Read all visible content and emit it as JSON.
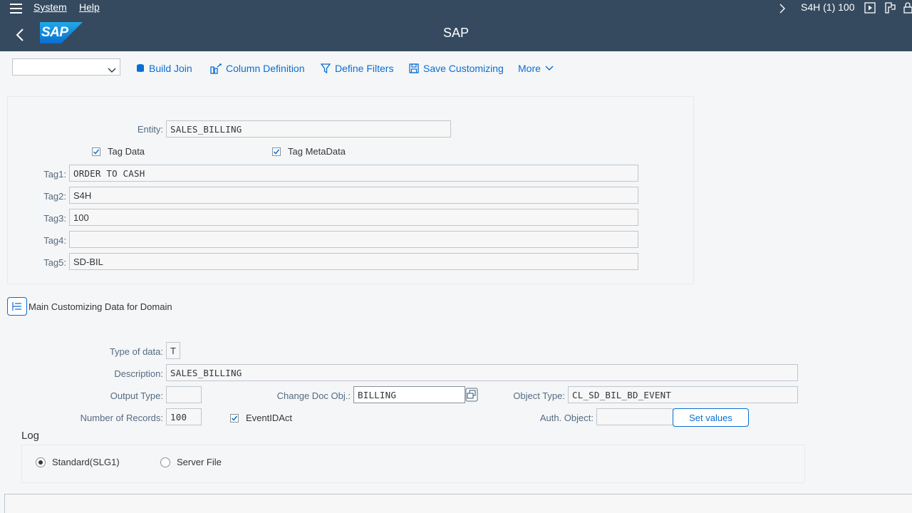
{
  "menu": {
    "system": "System",
    "help": "Help",
    "session": "S4H (1) 100"
  },
  "shell": {
    "logo": "SAP",
    "title": "SAP"
  },
  "toolbar": {
    "build_join": "Build Join",
    "column_definition": "Column Definition",
    "define_filters": "Define Filters",
    "save_customizing": "Save Customizing",
    "more": "More",
    "variant_select_value": ""
  },
  "entity": {
    "label": "Entity:",
    "value": "SALES_BILLING",
    "tag_data_label": "Tag Data",
    "tag_metadata_label": "Tag MetaData",
    "tags": [
      {
        "label": "Tag1:",
        "value": "ORDER TO CASH"
      },
      {
        "label": "Tag2:",
        "value": "S4H"
      },
      {
        "label": "Tag3:",
        "value": "100"
      },
      {
        "label": "Tag4:",
        "value": ""
      },
      {
        "label": "Tag5:",
        "value": "SD-BIL"
      }
    ]
  },
  "domain": {
    "section_title": "Main Customizing Data for Domain",
    "type_label": "Type of data:",
    "type_value": "T",
    "description_label": "Description:",
    "description_value": "SALES_BILLING",
    "output_type_label": "Output Type:",
    "output_type_value": "",
    "change_doc_label": "Change Doc Obj.:",
    "change_doc_value": "BILLING",
    "object_type_label": "Object Type:",
    "object_type_value": "CL_SD_BIL_BD_EVENT",
    "records_label": "Number of Records:",
    "records_value": "100",
    "eventid_label": "EventIDAct",
    "auth_label": "Auth. Object:",
    "auth_value": "",
    "set_values_label": "Set values"
  },
  "log": {
    "title": "Log",
    "standard_label": "Standard(SLG1)",
    "server_file_label": "Server File",
    "selected": "standard"
  },
  "colors": {
    "shell": "#354a5f",
    "accent": "#0a6ed1",
    "background": "#f5f6f7"
  }
}
